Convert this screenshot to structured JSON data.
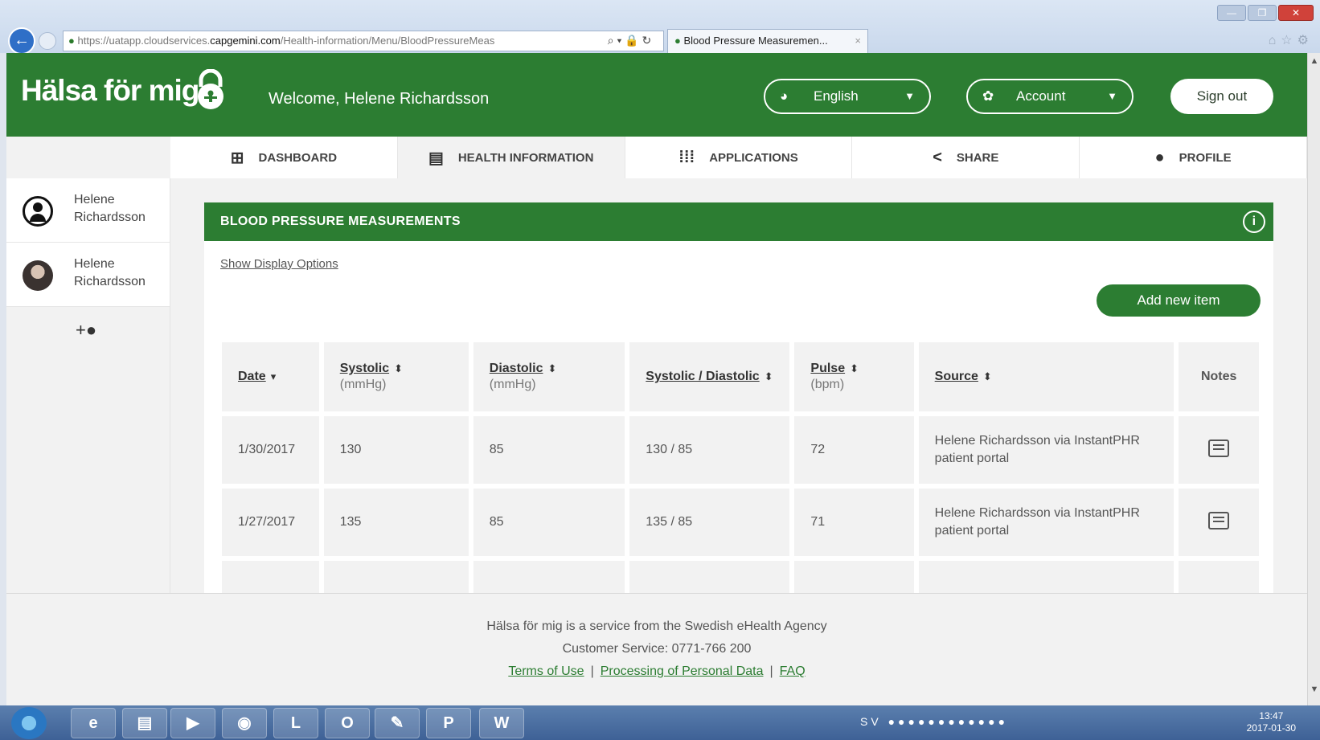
{
  "browser": {
    "url_prefix": "https://",
    "url_host_pre": "uatapp.cloudservices.",
    "url_host": "capgemini.com",
    "url_path": "/Health-information/Menu/BloodPressureMeas",
    "tab_title": "Blood Pressure Measuremen..."
  },
  "header": {
    "logo": "Hälsa för mig",
    "welcome": "Welcome, Helene Richardsson",
    "language": "English",
    "account": "Account",
    "sign_out": "Sign out"
  },
  "nav": {
    "items": [
      {
        "label": "DASHBOARD",
        "icon": "dashboard-icon"
      },
      {
        "label": "HEALTH INFORMATION",
        "icon": "health-info-icon"
      },
      {
        "label": "APPLICATIONS",
        "icon": "apps-grid-icon"
      },
      {
        "label": "SHARE",
        "icon": "share-icon"
      },
      {
        "label": "PROFILE",
        "icon": "person-icon"
      }
    ],
    "active": "HEALTH INFORMATION"
  },
  "sidebar": {
    "users": [
      {
        "first": "Helene",
        "last": "Richardsson",
        "avatar": "user-circle-icon"
      },
      {
        "first": "Helene",
        "last": "Richardsson",
        "avatar": "photo"
      }
    ]
  },
  "main": {
    "title": "BLOOD PRESSURE MEASUREMENTS",
    "display_options": "Show Display Options",
    "add_new": "Add new item",
    "columns": [
      {
        "label": "Date",
        "unit": "",
        "sort": "▾"
      },
      {
        "label": "Systolic",
        "unit": "(mmHg)",
        "sort": "⬍"
      },
      {
        "label": "Diastolic",
        "unit": "(mmHg)",
        "sort": "⬍"
      },
      {
        "label": "Systolic / Diastolic",
        "unit": "",
        "sort": "⬍"
      },
      {
        "label": "Pulse",
        "unit": "(bpm)",
        "sort": "⬍"
      },
      {
        "label": "Source",
        "unit": "",
        "sort": "⬍"
      },
      {
        "label": "Notes",
        "unit": "",
        "sort": ""
      }
    ],
    "rows": [
      {
        "date": "1/30/2017",
        "systolic": "130",
        "diastolic": "85",
        "sd": "130 / 85",
        "pulse": "72",
        "source": "Helene Richardsson via InstantPHR patient portal"
      },
      {
        "date": "1/27/2017",
        "systolic": "135",
        "diastolic": "85",
        "sd": "135 / 85",
        "pulse": "71",
        "source": "Helene Richardsson via InstantPHR patient portal"
      }
    ]
  },
  "footer": {
    "line1": "Hälsa för mig is a service from the Swedish eHealth Agency",
    "line2": "Customer Service: 0771-766 200",
    "terms": "Terms of Use",
    "processing": "Processing of Personal Data",
    "faq": "FAQ"
  },
  "taskbar": {
    "lang": "SV",
    "time": "13:47",
    "date": "2017-01-30"
  },
  "colors": {
    "brand_green": "#2c7d32"
  }
}
